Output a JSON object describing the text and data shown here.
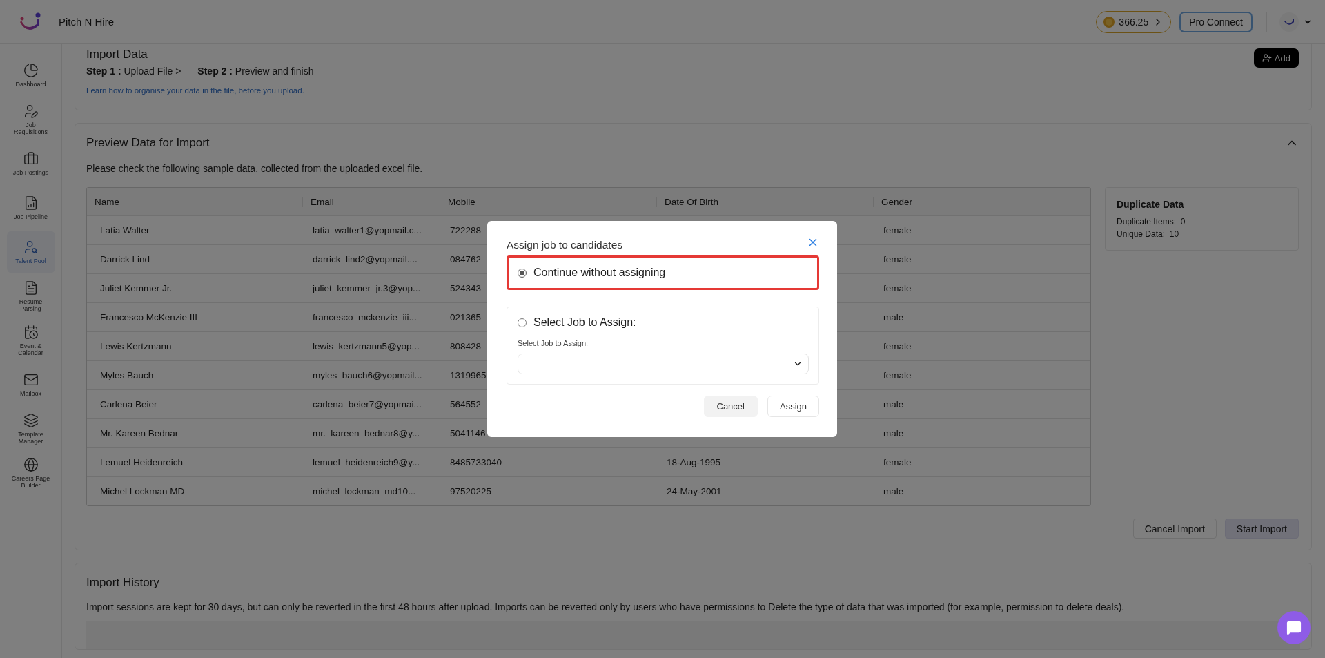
{
  "header": {
    "brand": "Pitch N Hire",
    "credits": "366.25",
    "pro_button": "Pro Connect"
  },
  "sidebar": {
    "items": [
      {
        "label": "Dashboard",
        "selected": false
      },
      {
        "label": "Job Requisitions",
        "selected": false
      },
      {
        "label": "Job Postings",
        "selected": false
      },
      {
        "label": "Job Pipeline",
        "selected": false
      },
      {
        "label": "Talent Pool",
        "selected": true
      },
      {
        "label": "Resume Parsing",
        "selected": false
      },
      {
        "label": "Event & Calendar",
        "selected": false
      },
      {
        "label": "Mailbox",
        "selected": false
      },
      {
        "label": "Template Manager",
        "selected": false
      },
      {
        "label": "Careers Page Builder",
        "selected": false
      }
    ]
  },
  "import_card": {
    "title": "Import Data",
    "steps": [
      {
        "label": "Step 1 :",
        "text": "Upload File >"
      },
      {
        "label": "Step 2 :",
        "text": "Preview and finish"
      }
    ],
    "link": "Learn how to organise your data in the file, before you upload.",
    "add_button": "Add"
  },
  "preview": {
    "title": "Preview Data for Import",
    "expanded": true,
    "subtitle": "Please check the following sample data, collected from the uploaded excel file.",
    "table": {
      "columns": [
        "Name",
        "Email",
        "Mobile",
        "Date Of Birth",
        "Gender"
      ],
      "rows": [
        {
          "name": "Latia Walter",
          "email": "latia_walter1@yopmail.c...",
          "mobile": "722288",
          "gender": "female"
        },
        {
          "name": "Darrick Lind",
          "email": "darrick_lind2@yopmail....",
          "mobile": "084762",
          "gender": "female"
        },
        {
          "name": "Juliet Kemmer Jr.",
          "email": "juliet_kemmer_jr.3@yop...",
          "mobile": "524343",
          "gender": "female"
        },
        {
          "name": "Francesco McKenzie III",
          "email": "francesco_mckenzie_iii...",
          "mobile": "021365",
          "gender": "male"
        },
        {
          "name": "Lewis Kertzmann",
          "email": "lewis_kertzmann5@yop...",
          "mobile": "808428",
          "gender": "female"
        },
        {
          "name": "Myles Bauch",
          "email": "myles_bauch6@yopmail...",
          "mobile": "1319965",
          "gender": "female"
        },
        {
          "name": "Carlena Beier",
          "email": "carlena_beier7@yopmai...",
          "mobile": "564552",
          "gender": "male"
        },
        {
          "name": "Mr. Kareen Bednar",
          "email": "mr._kareen_bednar8@y...",
          "mobile": "5041146",
          "gender": "male"
        },
        {
          "name": "Lemuel Heidenreich",
          "email": "lemuel_heidenreich9@y...",
          "mobile": "8485733040",
          "dob": "18-Aug-1995",
          "gender": "female"
        },
        {
          "name": "Michel Lockman MD",
          "email": "michel_lockman_md10...",
          "mobile": "97520225",
          "dob": "24-May-2001",
          "gender": "male"
        }
      ]
    },
    "duplicate": {
      "title": "Duplicate Data",
      "stats": [
        {
          "label": "Duplicate Items:",
          "value": "0"
        },
        {
          "label": "Unique Data:",
          "value": "10"
        }
      ]
    },
    "buttons": [
      "Cancel Import",
      "Start Import"
    ]
  },
  "history": {
    "title": "Import History",
    "text": "Import sessions are kept for 30 days, but can only be reverted in the first 48 hours after upload. Imports can be reverted only by users who have permissions to Delete the type of data that was imported (for example, permission to delete deals)."
  },
  "modal": {
    "title": "Assign job to candidates",
    "options": [
      {
        "label": "Continue without assigning",
        "selected": true,
        "highlighted": true
      },
      {
        "label": "Select Job to Assign:",
        "selected": false,
        "highlighted": false,
        "field_label": "Select Job to Assign:"
      }
    ],
    "buttons": [
      "Cancel",
      "Assign"
    ]
  }
}
